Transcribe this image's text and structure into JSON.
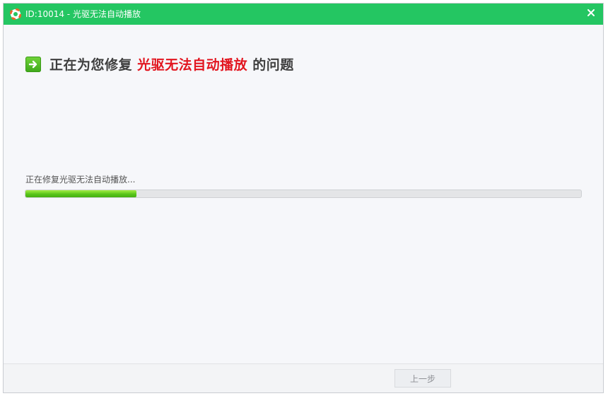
{
  "window": {
    "title": "ID:10014 - 光驱无法自动播放",
    "close_icon": "close-icon",
    "app_icon": "lifebuoy-icon"
  },
  "heading": {
    "prefix": "正在为您修复",
    "highlight": "光驱无法自动播放",
    "suffix": "的问题",
    "icon": "arrow-right-icon"
  },
  "progress": {
    "status_text": "正在修复光驱无法自动播放...",
    "percent": 20
  },
  "footer": {
    "prev_label": "上一步"
  },
  "colors": {
    "titlebar": "#24c662",
    "highlight": "#e2151f",
    "progress_fill": "#6fd620"
  }
}
